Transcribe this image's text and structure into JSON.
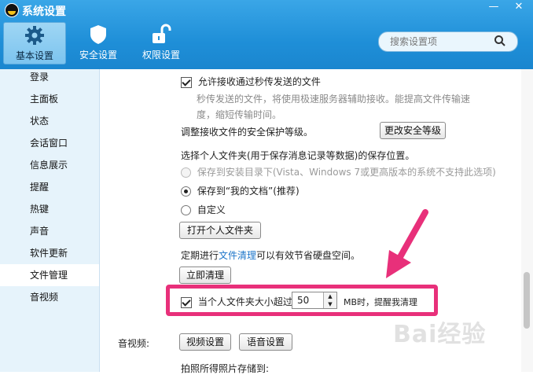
{
  "window": {
    "title": "系统设置",
    "controls": [
      "—",
      "✕"
    ]
  },
  "toolbar": {
    "tabs": [
      {
        "label": "基本设置",
        "icon": "gear-icon",
        "active": true
      },
      {
        "label": "安全设置",
        "icon": "shield-icon",
        "active": false
      },
      {
        "label": "权限设置",
        "icon": "lock-icon",
        "active": false
      }
    ],
    "search_placeholder": "搜索设置项"
  },
  "sidebar": {
    "items": [
      {
        "label": "登录"
      },
      {
        "label": "主面板"
      },
      {
        "label": "状态"
      },
      {
        "label": "会话窗口"
      },
      {
        "label": "信息展示"
      },
      {
        "label": "提醒"
      },
      {
        "label": "热键"
      },
      {
        "label": "声音"
      },
      {
        "label": "软件更新"
      },
      {
        "label": "文件管理",
        "active": true
      },
      {
        "label": "音视频"
      }
    ]
  },
  "content": {
    "allow_transfer_label": "允许接收通过秒传发送的文件",
    "allow_transfer_desc": "秒传发送的文件，将使用极速服务器辅助接收。能提高文件传输速度，缩短传输时间。",
    "security_level_label": "调整接收文件的安全保护等级。",
    "security_level_button": "更改安全等级",
    "folder_choice_label": "选择个人文件夹(用于保存消息记录等数据)的保存位置。",
    "radio_install_dir": "保存到安装目录下(Vista、Windows 7或更高版本的系统不支持此选项)",
    "radio_my_documents": "保存到“我的文档”(推荐)",
    "radio_custom": "自定义",
    "open_folder_button": "打开个人文件夹",
    "cleanup_prefix": "定期进行",
    "cleanup_link": "文件清理",
    "cleanup_suffix": "可以有效节省硬盘空间。",
    "cleanup_now_button": "立即清理",
    "size_alert_label": "当个人文件夹大小超过",
    "size_alert_value": "50",
    "size_alert_suffix": "MB时，提醒我清理",
    "av_section_label": "音视频:",
    "video_settings_button": "视频设置",
    "audio_settings_button": "语音设置",
    "photo_save_label": "拍照所得照片存储到:"
  },
  "watermark": "Bai经验",
  "colors": {
    "title_bar": "#1f8fd8",
    "highlight": "#e8307a",
    "sidebar_bg": "#e6f3fb",
    "link": "#1b74c9"
  }
}
